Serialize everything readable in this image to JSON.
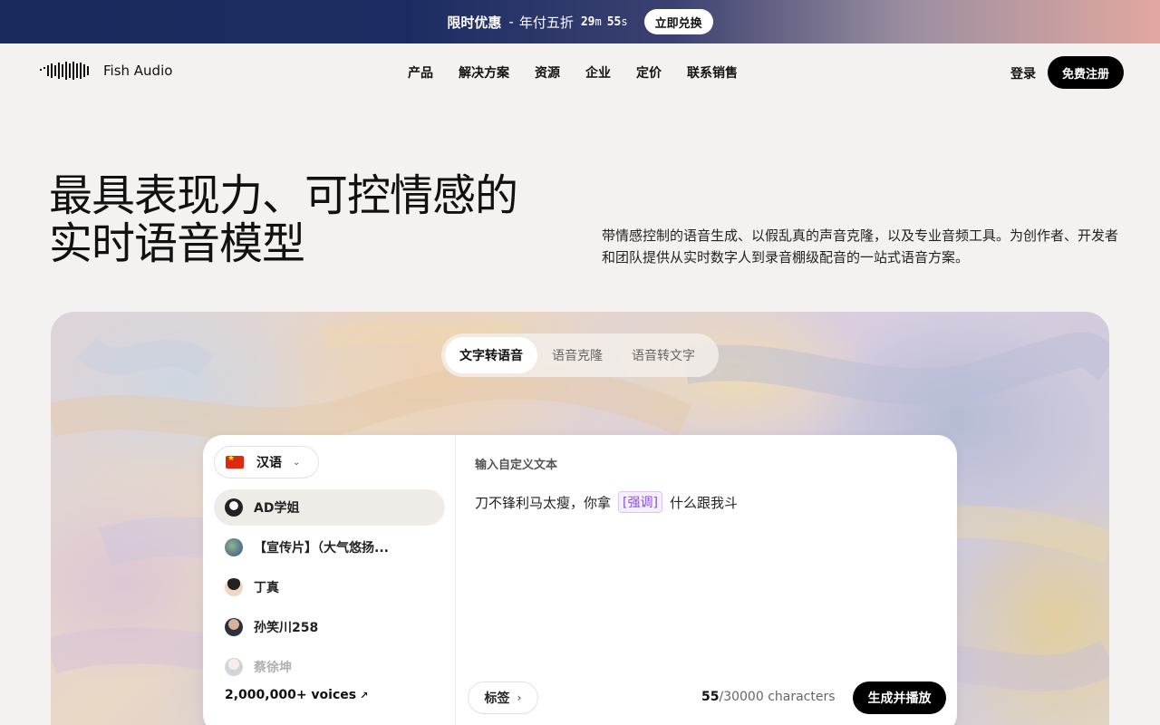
{
  "promo": {
    "title": "限时优惠",
    "separator": "-",
    "offer": "年付五折",
    "minutes": "29",
    "minutes_unit": "m",
    "seconds": "55",
    "seconds_unit": "s",
    "cta": "立即兑换"
  },
  "header": {
    "brand": "Fish Audio",
    "menu": [
      "产品",
      "解决方案",
      "资源",
      "企业",
      "定价",
      "联系销售"
    ],
    "login": "登录",
    "signup": "免费注册"
  },
  "hero": {
    "title_line1": "最具表现力、可控情感的",
    "title_line2": "实时语音模型",
    "subtitle": "带情感控制的语音生成、以假乱真的声音克隆，以及专业音频工具。为创作者、开发者和团队提供从实时数字人到录音棚级配音的一站式语音方案。"
  },
  "tabs": [
    {
      "label": "文字转语音",
      "active": true
    },
    {
      "label": "语音克隆",
      "active": false
    },
    {
      "label": "语音转文字",
      "active": false
    }
  ],
  "tts": {
    "language": "汉语",
    "voices": [
      {
        "name": "AD学姐",
        "active": true
      },
      {
        "name": "【宣传片】（大气悠扬..."
      },
      {
        "name": "丁真"
      },
      {
        "name": "孙笑川258"
      },
      {
        "name": "蔡徐坤"
      }
    ],
    "voices_link": "2,000,000+ voices",
    "input_label": "输入自定义文本",
    "text_before": "刀不锋利马太瘦，你拿",
    "text_tag": "[强调]",
    "text_after": "什么跟我斗",
    "tags_button": "标签",
    "count_current": "55",
    "count_rest": "/30000 characters",
    "generate_button": "生成并播放"
  },
  "colors": {
    "accent": "#000000",
    "tag_purple": "#8a4fd8",
    "promo_start": "#1b2a5c",
    "promo_end": "#e3a8a0"
  }
}
